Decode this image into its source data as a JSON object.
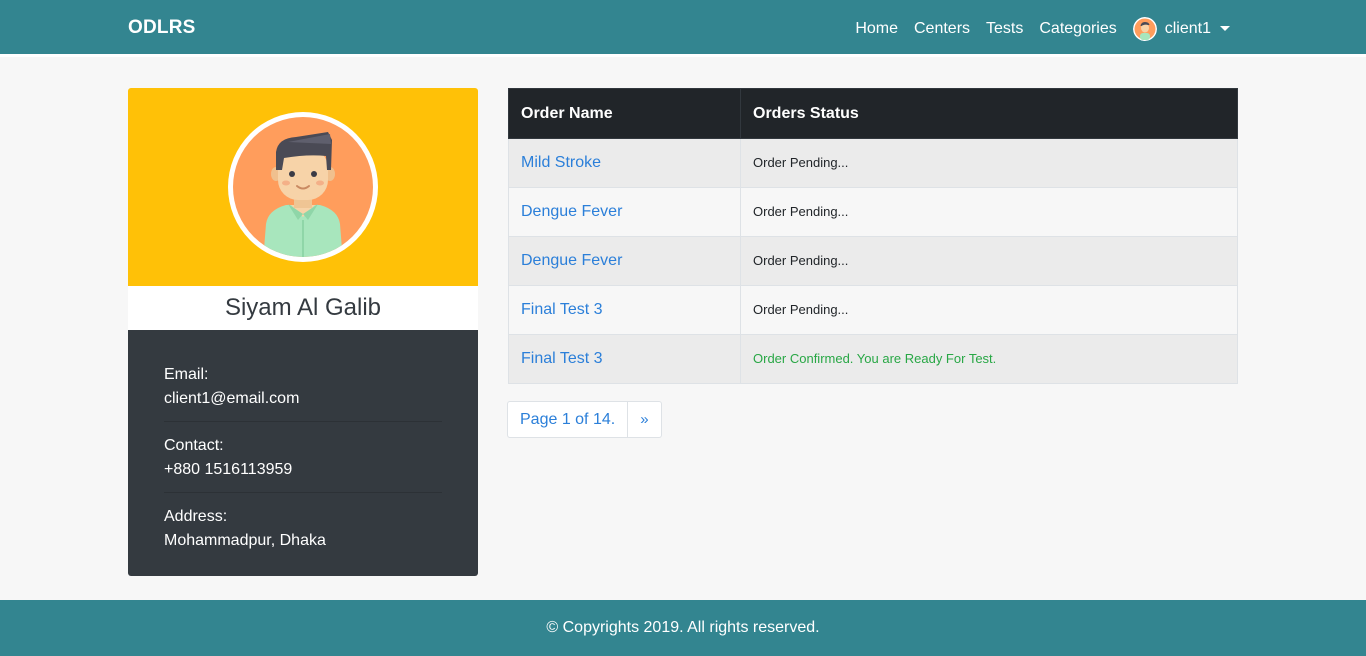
{
  "navbar": {
    "brand": "ODLRS",
    "links": [
      "Home",
      "Centers",
      "Tests",
      "Categories"
    ],
    "user_label": "client1"
  },
  "profile": {
    "name": "Siyam Al Galib",
    "email_label": "Email:",
    "email": "client1@email.com",
    "contact_label": "Contact:",
    "contact": "+880 1516113959",
    "address_label": "Address:",
    "address": "Mohammadpur, Dhaka"
  },
  "orders": {
    "headers": [
      "Order Name",
      "Orders Status"
    ],
    "rows": [
      {
        "name": "Mild Stroke",
        "status": "Order Pending..."
      },
      {
        "name": "Dengue Fever",
        "status": "Order Pending..."
      },
      {
        "name": "Dengue Fever",
        "status": "Order Pending..."
      },
      {
        "name": "Final Test 3",
        "status": "Order Pending..."
      },
      {
        "name": "Final Test 3",
        "status": "Order Confirmed. You are Ready For Test."
      }
    ]
  },
  "pagination": {
    "page_text": "Page 1 of 14.",
    "next": "»"
  },
  "footer": {
    "text": "© Copyrights 2019. All rights reserved."
  },
  "colors": {
    "navbar_bg": "#338590",
    "profile_header_bg": "#ffc107",
    "details_bg": "#343a40",
    "table_header_bg": "#212529",
    "link": "#2b7fd9",
    "confirmed": "#28a745"
  }
}
